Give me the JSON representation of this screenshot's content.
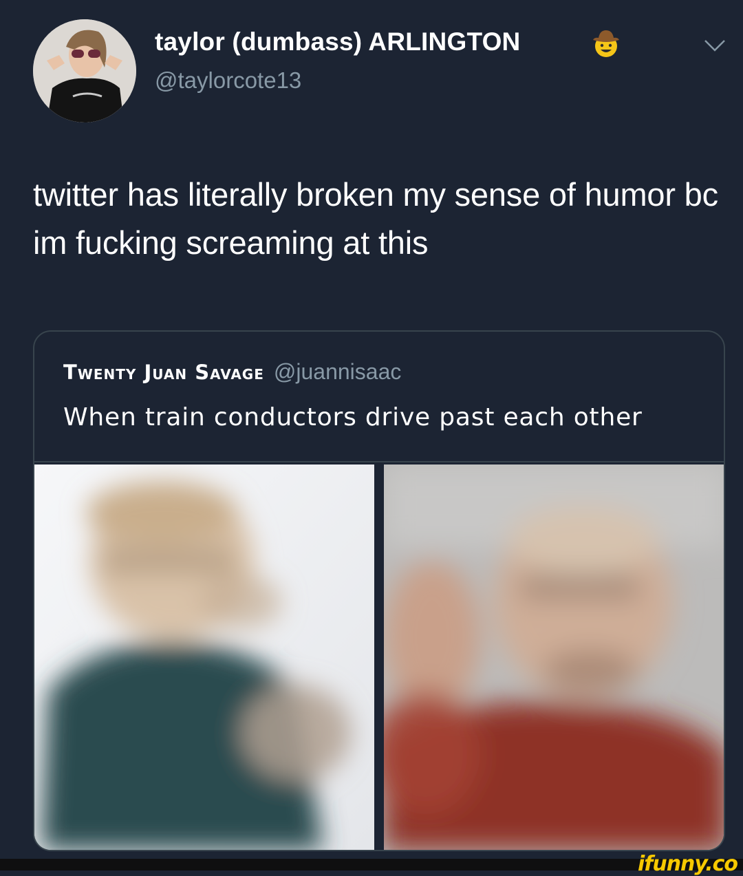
{
  "tweet": {
    "display_name": "taylor (dumbass) ARLINGTON",
    "handle": "@taylorcote13",
    "text": "twitter has literally broken my sense of humor bc im fucking screaming at this",
    "icons": {
      "name_emoji": "cowboy-hat-face-emoji",
      "menu": "chevron-down-icon"
    }
  },
  "quoted_tweet": {
    "display_name": "Twenty Juan Savage",
    "handle": "@juannisaac",
    "text": "When train conductors drive past each other",
    "images": [
      "blurred-man-teal-shirt",
      "blurred-man-red-shirt"
    ]
  },
  "watermark": "ifunny.co",
  "colors": {
    "background": "#1c2433",
    "secondary_text": "#8899a6",
    "border": "#38444d",
    "watermark": "#f7c900"
  }
}
